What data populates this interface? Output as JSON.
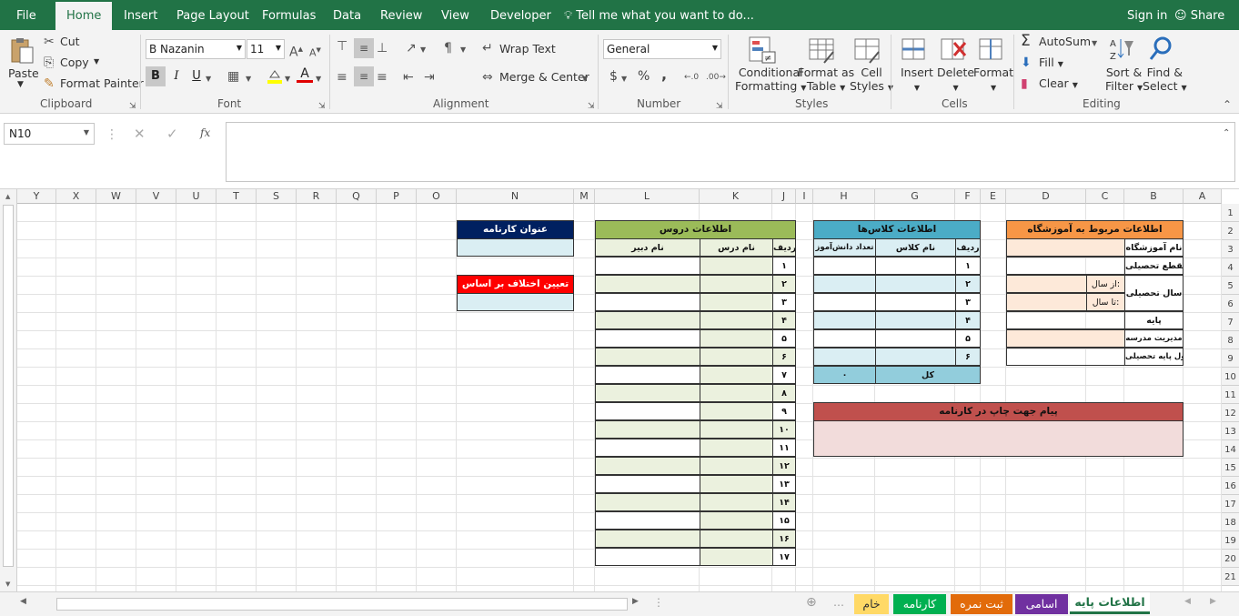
{
  "tabs": {
    "file": "File",
    "home": "Home",
    "insert": "Insert",
    "page_layout": "Page Layout",
    "formulas": "Formulas",
    "data": "Data",
    "review": "Review",
    "view": "View",
    "developer": "Developer",
    "tell_me": "Tell me what you want to do...",
    "sign_in": "Sign in",
    "share": "Share"
  },
  "clipboard": {
    "paste": "Paste",
    "cut": "Cut",
    "copy": "Copy",
    "format_painter": "Format Painter",
    "group": "Clipboard"
  },
  "font": {
    "name": "B Nazanin",
    "size": "11",
    "bold": "B",
    "italic": "I",
    "underline": "U",
    "group": "Font"
  },
  "alignment": {
    "wrap_text": "Wrap Text",
    "merge_center": "Merge & Center",
    "group": "Alignment"
  },
  "number": {
    "format": "General",
    "currency": "$",
    "percent": "%",
    "comma": ",",
    "group": "Number"
  },
  "styles": {
    "conditional_1": "Conditional",
    "conditional_2": "Formatting",
    "format_table_1": "Format as",
    "format_table_2": "Table",
    "cell_styles_1": "Cell",
    "cell_styles_2": "Styles",
    "group": "Styles"
  },
  "cells": {
    "insert": "Insert",
    "delete": "Delete",
    "format": "Format",
    "group": "Cells"
  },
  "editing": {
    "autosum": "AutoSum",
    "fill": "Fill",
    "clear": "Clear",
    "sort_1": "Sort &",
    "sort_2": "Filter",
    "find_1": "Find &",
    "find_2": "Select",
    "group": "Editing"
  },
  "formula_bar": {
    "name_box": "N10",
    "fx": "fx",
    "content": ""
  },
  "columns": [
    "Y",
    "X",
    "W",
    "V",
    "U",
    "T",
    "S",
    "R",
    "Q",
    "P",
    "O",
    "N",
    "M",
    "L",
    "K",
    "J",
    "I",
    "H",
    "G",
    "F",
    "E",
    "D",
    "C",
    "B",
    "A"
  ],
  "rows": [
    "1",
    "2",
    "3",
    "4",
    "5",
    "6",
    "7",
    "8",
    "9",
    "10",
    "11",
    "12",
    "13",
    "14",
    "15",
    "16",
    "17",
    "18",
    "19",
    "20",
    "21"
  ],
  "report": {
    "title": "عنوان کارنامه",
    "diff_title": "تعیین اختلاف بر اساس"
  },
  "courses": {
    "header": "اطلاعات دروس",
    "col_row": "ردیف",
    "col_course": "نام درس",
    "col_teacher": "نام دبیر",
    "rows": [
      "۱",
      "۲",
      "۳",
      "۴",
      "۵",
      "۶",
      "۷",
      "۸",
      "۹",
      "۱۰",
      "۱۱",
      "۱۲",
      "۱۳",
      "۱۴",
      "۱۵",
      "۱۶",
      "۱۷"
    ]
  },
  "classes": {
    "header": "اطلاعات کلاس‌ها",
    "col_row": "ردیف",
    "col_class": "نام کلاس",
    "col_count": "تعداد دانش‌آموز",
    "rows": [
      "۱",
      "۲",
      "۳",
      "۴",
      "۵",
      "۶"
    ],
    "total_label": "کل",
    "total_value": "۰"
  },
  "school": {
    "header": "اطلاعات مربوط به آموزشگاه",
    "name": "نام آموزشگاه",
    "level": "مقطع تحصیلی",
    "year": "سال تحصیلی",
    "from": "از سال:",
    "to": "تا سال:",
    "grade": "پایه",
    "principal": "مدیریت مدرسه",
    "grade_admin": "مسئول پایه تحصیلی"
  },
  "message": {
    "header": "پیام جهت چاپ در کارنامه"
  },
  "sheets": [
    {
      "name": "اطلاعات پایه",
      "color": "#ffffff",
      "text": "#217346"
    },
    {
      "name": "اسامی",
      "color": "#7030a0",
      "text": "#ffffff"
    },
    {
      "name": "ثبت نمره",
      "color": "#e26b0a",
      "text": "#ffffff"
    },
    {
      "name": "کارنامه",
      "color": "#00b050",
      "text": "#ffffff"
    },
    {
      "name": "خام",
      "color": "#ffd966",
      "text": "#333333"
    }
  ],
  "colors": {
    "excel_green": "#217346",
    "courses_green": "#9bbb59",
    "courses_light": "#ebf1de",
    "classes_blue": "#4bacc6",
    "classes_light": "#daeef3",
    "school_orange": "#f79646",
    "school_light": "#fde9d9",
    "message_red": "#c0504d",
    "message_light": "#f2dcdb",
    "report_navy": "#002060",
    "diff_red": "#ff0000"
  }
}
